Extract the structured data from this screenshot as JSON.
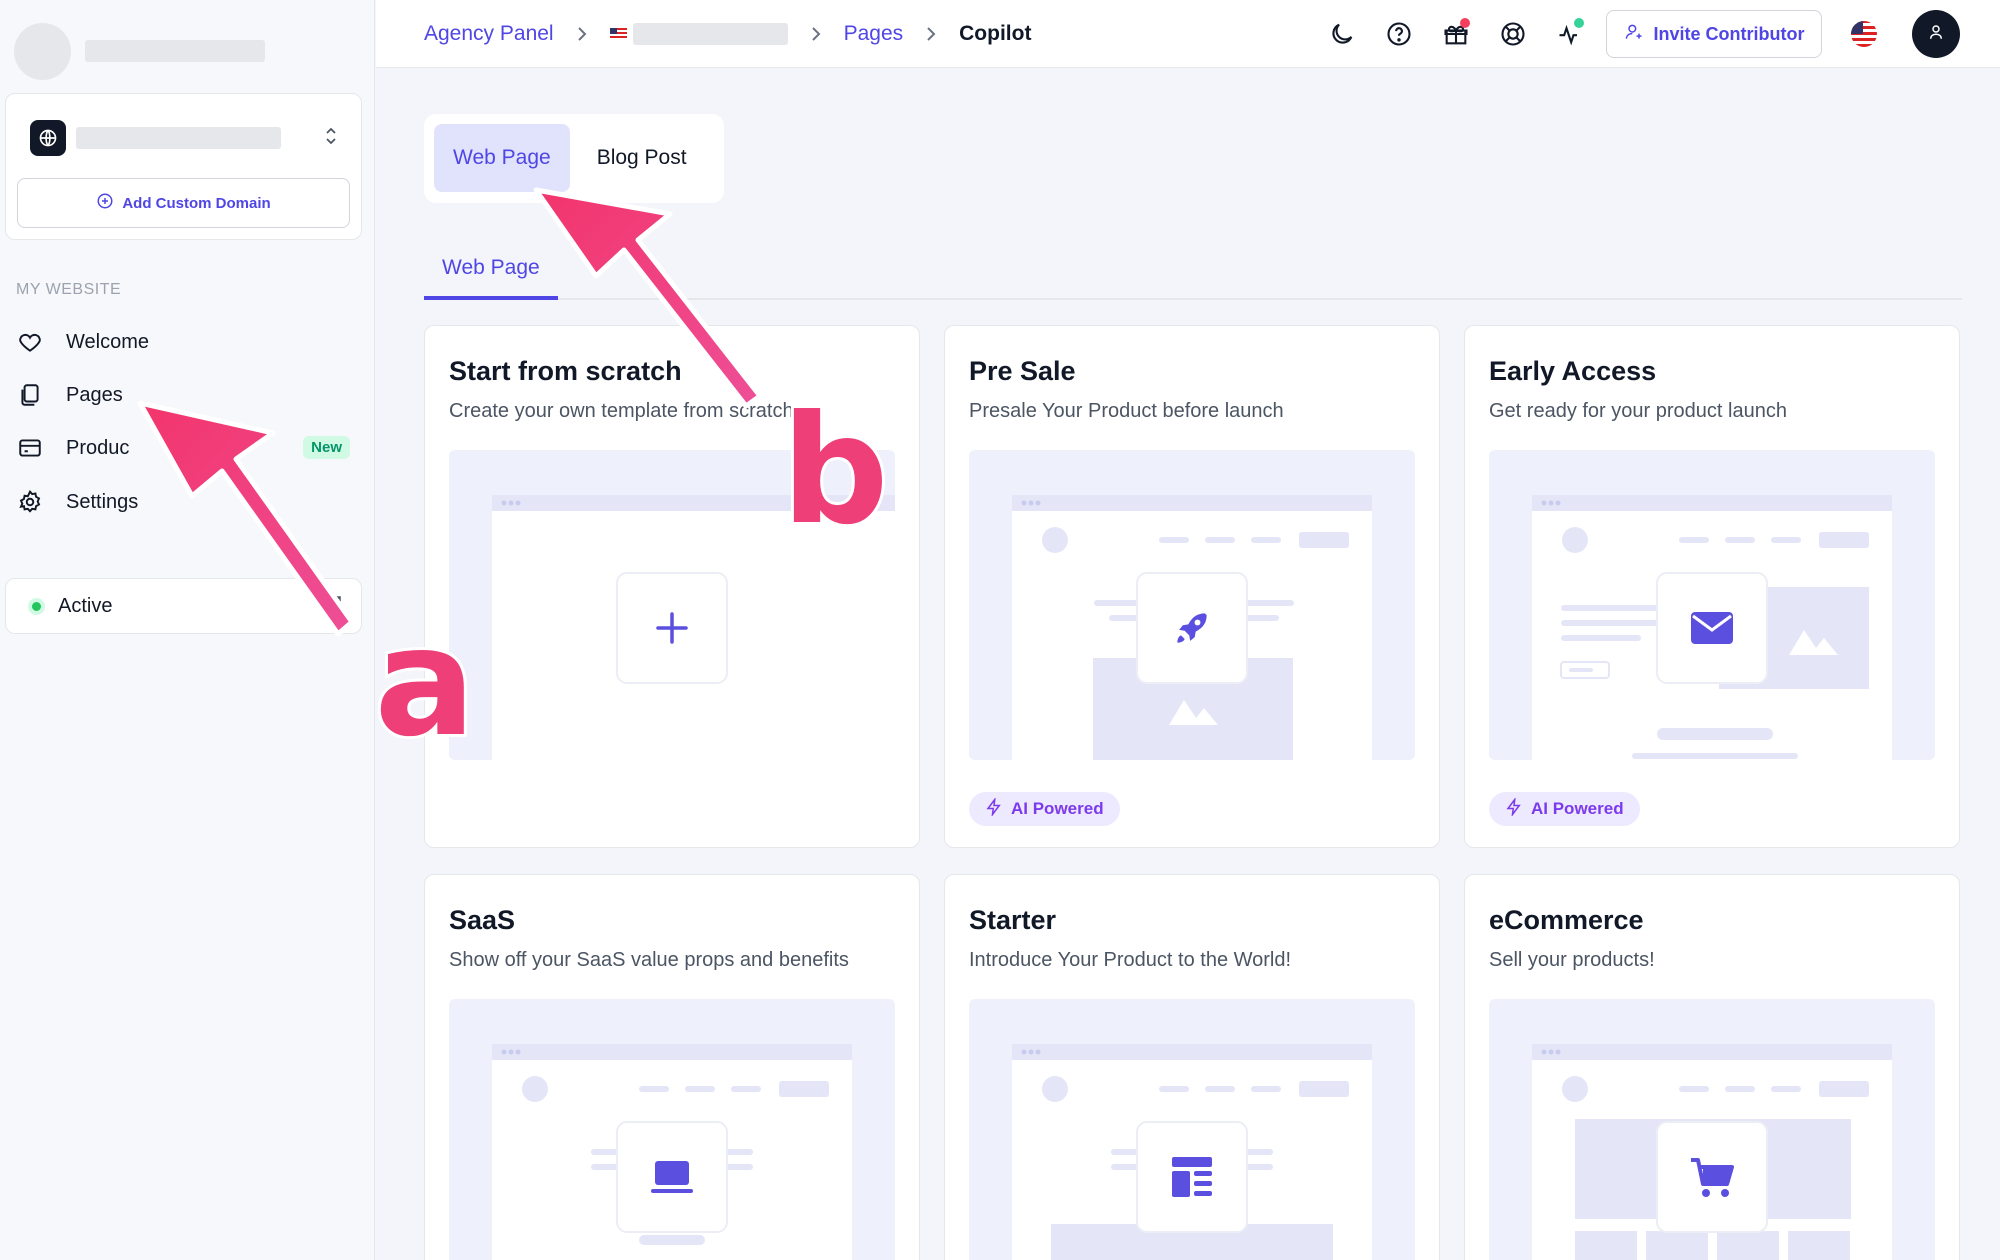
{
  "sidebar": {
    "add_domain_label": "Add Custom Domain",
    "section_label": "MY WEBSITE",
    "items": [
      {
        "label": "Welcome",
        "icon": "heart-icon"
      },
      {
        "label": "Pages",
        "icon": "pages-icon"
      },
      {
        "label": "Produc",
        "icon": "card-icon",
        "badge": "New"
      },
      {
        "label": "Settings",
        "icon": "gear-icon"
      }
    ],
    "status_label": "Active"
  },
  "topbar": {
    "breadcrumb": [
      "Agency Panel",
      "Pages",
      "Copilot"
    ],
    "invite_label": "Invite Contributor",
    "icons": [
      "moon-icon",
      "help-icon",
      "gift-icon",
      "support-icon",
      "activity-icon"
    ]
  },
  "main": {
    "type_tabs": [
      "Web Page",
      "Blog Post"
    ],
    "subtab": "Web Page",
    "ai_badge_label": "AI Powered",
    "cards": [
      {
        "title": "Start from scratch",
        "desc": "Create your own template from scratch."
      },
      {
        "title": "Pre Sale",
        "desc": "Presale Your Product before launch",
        "ai": true
      },
      {
        "title": "Early Access",
        "desc": "Get ready for your product launch",
        "ai": true
      },
      {
        "title": "SaaS",
        "desc": "Show off your SaaS value props and benefits"
      },
      {
        "title": "Starter",
        "desc": "Introduce Your Product to the World!"
      },
      {
        "title": "eCommerce",
        "desc": "Sell your products!"
      }
    ]
  },
  "annotations": {
    "a": "a",
    "b": "b"
  },
  "colors": {
    "accent": "#4f46e5",
    "arrow": "#ef3f78",
    "success": "#22c55e"
  }
}
